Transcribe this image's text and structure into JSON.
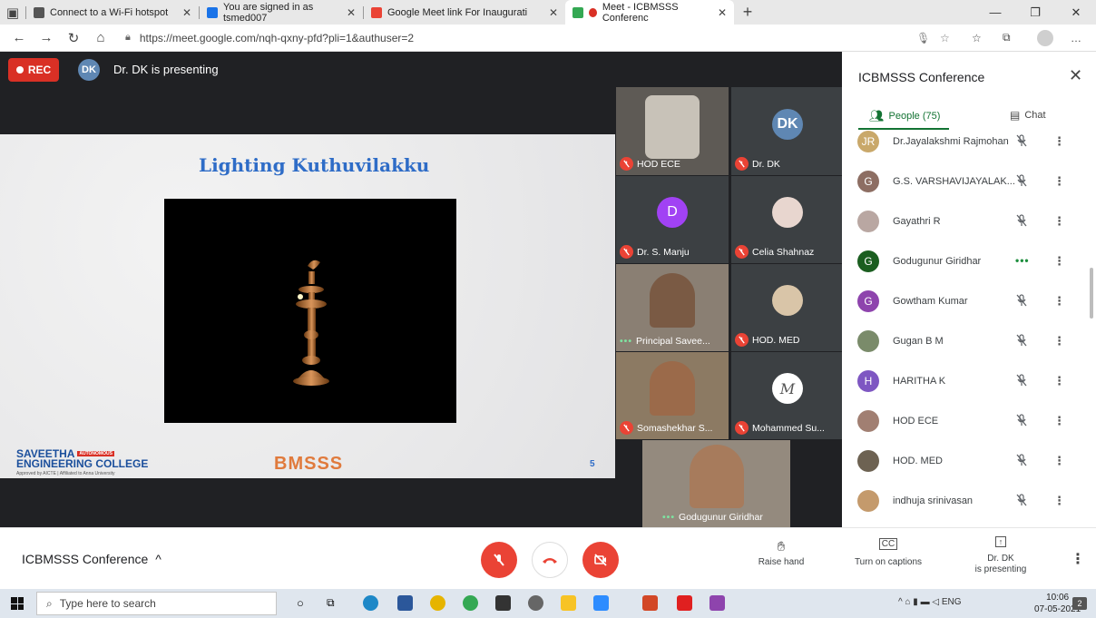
{
  "browser": {
    "tabs": [
      {
        "title": "Connect to a Wi-Fi hotspot",
        "color": "#555555"
      },
      {
        "title": "You are signed in as tsmed007",
        "color": "#1a73e8"
      },
      {
        "title": "Google Meet link For Inaugurati",
        "color": "#ea4335"
      },
      {
        "title": "Meet - ICBMSSS Conferenc",
        "color": "#34a853"
      }
    ],
    "url": "https://meet.google.com/nqh-qxny-pfd?pli=1&authuser=2"
  },
  "meet": {
    "rec_label": "REC",
    "presenter_initials": "DK",
    "presenting_text": "Dr. DK is presenting",
    "slide": {
      "title": "Lighting Kuthuvilakku",
      "college_name_1": "SAVEETHA",
      "college_badge": "AUTONOMOUS",
      "college_name_2": "ENGINEERING COLLEGE",
      "college_sub": "Approved by AICTE | Affiliated to Anna University",
      "brand": "BMSSS",
      "page_number": "5"
    },
    "tiles": [
      {
        "name": "HOD ECE",
        "status": "muted"
      },
      {
        "name": "Dr. DK",
        "initials": "DK",
        "status": "muted"
      },
      {
        "name": "Dr. S. Manju",
        "initial": "D",
        "status": "muted"
      },
      {
        "name": "Celia Shahnaz",
        "status": "muted"
      },
      {
        "name": "Principal Savee...",
        "status": "speaking"
      },
      {
        "name": "HOD. MED",
        "status": "muted"
      },
      {
        "name": "Somashekhar S...",
        "status": "muted"
      },
      {
        "name": "Mohammed Su...",
        "status": "muted"
      },
      {
        "name": "Godugunur Giridhar",
        "status": "speaking"
      }
    ]
  },
  "panel": {
    "title": "ICBMSSS Conference",
    "tab_people": "People (75)",
    "tab_chat": "Chat",
    "participants": [
      {
        "name": "Dr.Jayalakshmi Rajmohan",
        "initial": "JR",
        "color": "#c9a86a",
        "status": "muted"
      },
      {
        "name": "G.S. VARSHAVIJAYALAK...",
        "initial": "G",
        "color": "#8d6e63",
        "status": "muted"
      },
      {
        "name": "Gayathri R",
        "initial": "",
        "color": "#b9a7a2",
        "status": "muted"
      },
      {
        "name": "Godugunur Giridhar",
        "initial": "G",
        "color": "#1b5e20",
        "status": "speaking"
      },
      {
        "name": "Gowtham Kumar",
        "initial": "G",
        "color": "#8e44ad",
        "status": "muted"
      },
      {
        "name": "Gugan B M",
        "initial": "",
        "color": "#7a8b6a",
        "status": "muted"
      },
      {
        "name": "HARITHA K",
        "initial": "H",
        "color": "#7e57c2",
        "status": "muted"
      },
      {
        "name": "HOD ECE",
        "initial": "",
        "color": "#a17f72",
        "status": "muted"
      },
      {
        "name": "HOD. MED",
        "initial": "",
        "color": "#6d6252",
        "status": "muted"
      },
      {
        "name": "indhuja srinivasan",
        "initial": "",
        "color": "#c49a6c",
        "status": "muted"
      }
    ]
  },
  "bottombar": {
    "meeting_name": "ICBMSSS Conference",
    "raise_hand": "Raise hand",
    "captions": "Turn on captions",
    "presenting_1": "Dr. DK",
    "presenting_2": "is presenting"
  },
  "taskbar": {
    "search_placeholder": "Type here to search",
    "lang": "ENG",
    "time": "10:06",
    "date": "07-05-2021",
    "notifications": "2"
  }
}
